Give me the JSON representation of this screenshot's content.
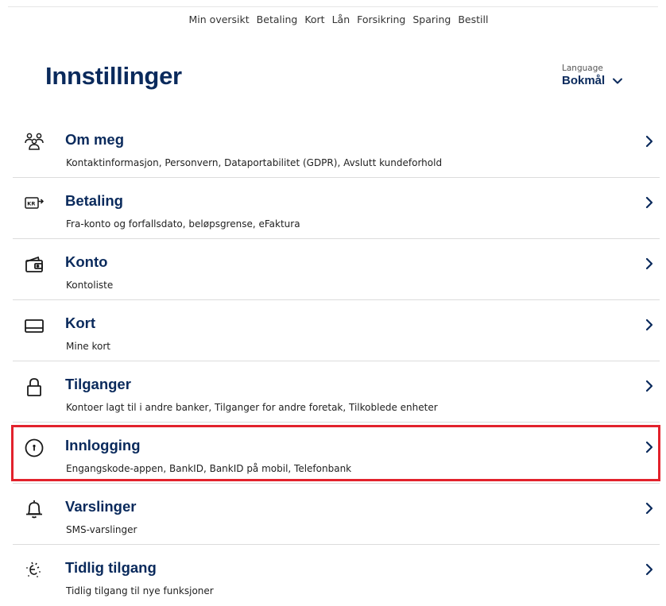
{
  "topnav": {
    "items": [
      "Min oversikt",
      "Betaling",
      "Kort",
      "Lån",
      "Forsikring",
      "Sparing",
      "Bestill"
    ]
  },
  "page": {
    "title": "Innstillinger"
  },
  "language": {
    "caption": "Language",
    "value": "Bokmål",
    "icon": "chevron-down-icon"
  },
  "colors": {
    "heading": "#0a2a5c",
    "highlight": "#e2222c",
    "divider": "#dcdcdc"
  },
  "menu": {
    "items": [
      {
        "title": "Om meg",
        "subtitle": "Kontaktinformasjon, Personvern, Dataportabilitet (GDPR), Avslutt kundeforhold",
        "icon": "people-icon"
      },
      {
        "title": "Betaling",
        "subtitle": "Fra-konto og forfallsdato, beløpsgrense, eFaktura",
        "icon": "payment-transfer-icon"
      },
      {
        "title": "Konto",
        "subtitle": "Kontoliste",
        "icon": "wallet-icon"
      },
      {
        "title": "Kort",
        "subtitle": "Mine kort",
        "icon": "card-icon"
      },
      {
        "title": "Tilganger",
        "subtitle": "Kontoer lagt til i andre banker, Tilganger for andre foretak, Tilkoblede enheter",
        "icon": "padlock-icon"
      },
      {
        "title": "Innlogging",
        "subtitle": "Engangskode-appen, BankID, BankID på mobil, Telefonbank",
        "icon": "keyhole-icon"
      },
      {
        "title": "Varslinger",
        "subtitle": "SMS-varslinger",
        "icon": "bell-icon"
      },
      {
        "title": "Tidlig tilgang",
        "subtitle": "Tidlig tilgang til nye funksjoner",
        "icon": "sparkle-icon"
      }
    ]
  }
}
